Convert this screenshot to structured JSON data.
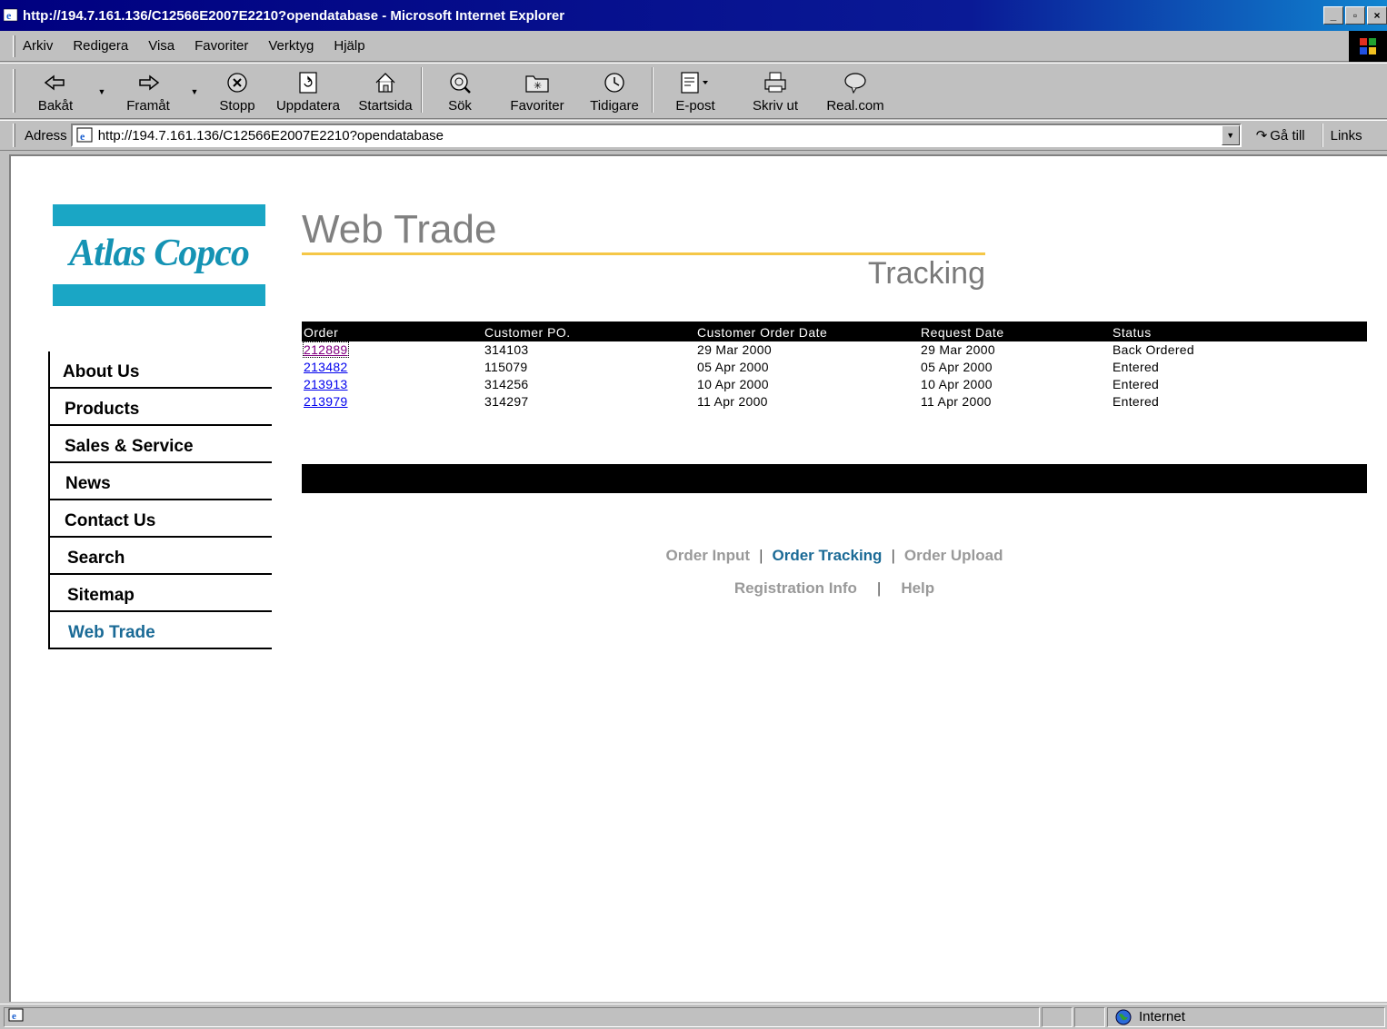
{
  "window": {
    "title": "http://194.7.161.136/C12566E2007E2210?opendatabase - Microsoft Internet Explorer"
  },
  "menu": [
    "Arkiv",
    "Redigera",
    "Visa",
    "Favoriter",
    "Verktyg",
    "Hjälp"
  ],
  "toolbar": {
    "back": "Bakåt",
    "forward": "Framåt",
    "stop": "Stopp",
    "refresh": "Uppdatera",
    "home": "Startsida",
    "search": "Sök",
    "favorites": "Favoriter",
    "history": "Tidigare",
    "mail": "E-post",
    "print": "Skriv ut",
    "real": "Real.com"
  },
  "address": {
    "label": "Adress",
    "url": "http://194.7.161.136/C12566E2007E2210?opendatabase",
    "go": "Gå till",
    "links": "Links"
  },
  "page": {
    "logo": "Atlas Copco",
    "title": "Web Trade",
    "subtitle": "Tracking",
    "nav": [
      "About Us",
      "Products",
      "Sales & Service",
      "News",
      "Contact Us",
      "Search",
      "Sitemap",
      "Web Trade"
    ],
    "table": {
      "headers": [
        "Order",
        "Customer PO.",
        "Customer Order Date",
        "Request Date",
        "Status"
      ],
      "rows": [
        [
          "212889",
          "314103",
          "29 Mar 2000",
          "29 Mar 2000",
          "Back Ordered"
        ],
        [
          "213482",
          "115079",
          "05 Apr 2000",
          "05 Apr 2000",
          "Entered"
        ],
        [
          "213913",
          "314256",
          "10 Apr 2000",
          "10 Apr 2000",
          "Entered"
        ],
        [
          "213979",
          "314297",
          "11 Apr 2000",
          "11 Apr 2000",
          "Entered"
        ]
      ]
    },
    "footer": {
      "order_input": "Order Input",
      "order_tracking": "Order Tracking",
      "order_upload": "Order Upload",
      "registration_info": "Registration Info",
      "help": "Help",
      "separator": "|"
    }
  },
  "status": {
    "zone": "Internet"
  },
  "colors": {
    "accent": "#1a6a96",
    "logo": "#1aa6c5",
    "rule": "#f5c747"
  }
}
